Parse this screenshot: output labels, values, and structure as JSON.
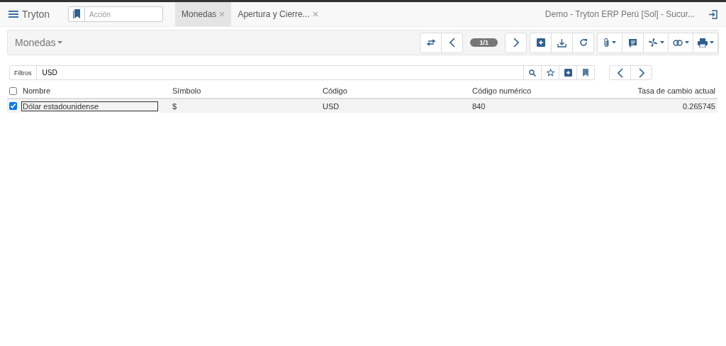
{
  "header": {
    "app_name": "Tryton",
    "action_placeholder": "Acción",
    "tabs": [
      {
        "label": "Monedas",
        "selected": true
      },
      {
        "label": "Apertura y Cierre...",
        "selected": false
      }
    ],
    "company": "Demo - Tryton ERP Perú [Sol] - Sucur..."
  },
  "toolbar": {
    "title": "Monedas",
    "page": "1/1"
  },
  "filter": {
    "label": "Filtros",
    "value": "USD"
  },
  "table": {
    "all_checked": false,
    "columns": [
      {
        "label": "Nombre",
        "kind": "text"
      },
      {
        "label": "Símbolo",
        "kind": "text"
      },
      {
        "label": "Código",
        "kind": "text"
      },
      {
        "label": "Código numérico",
        "kind": "text"
      },
      {
        "label": "Tasa de cambio actual",
        "kind": "number"
      }
    ],
    "rows": [
      {
        "selected": true,
        "cells": [
          {
            "text": "Dólar estadounidense",
            "focused": true
          },
          {
            "text": "$",
            "focused": false
          },
          {
            "text": "USD",
            "focused": false
          },
          {
            "text": "840",
            "focused": false
          },
          {
            "text": "0.265745",
            "focused": false
          }
        ]
      }
    ]
  }
}
